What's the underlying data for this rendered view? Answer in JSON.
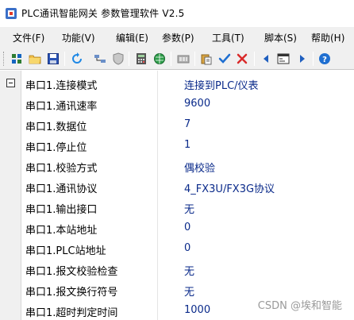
{
  "window": {
    "title": "PLC通讯智能网关 参数管理软件 V2.5"
  },
  "menu": [
    {
      "label": "文件(F)"
    },
    {
      "label": "功能(V)"
    },
    {
      "label": "编辑(E)"
    },
    {
      "label": "参数(P)"
    },
    {
      "label": "工具(T)"
    },
    {
      "label": "脚本(S)"
    },
    {
      "label": "帮助(H)"
    }
  ],
  "toolbar": {
    "icons": [
      "grid-tool-icon",
      "open-folder-icon",
      "save-icon",
      "refresh-icon",
      "network-icon",
      "shield-icon",
      "calculator-icon",
      "world-icon",
      "device-icon",
      "paste-icon",
      "check-icon",
      "delete-icon",
      "prev-icon",
      "terminal-icon",
      "next-icon",
      "help-icon"
    ]
  },
  "properties": [
    {
      "label": "串口1.连接模式",
      "value": "连接到PLC/仪表"
    },
    {
      "label": "串口1.通讯速率",
      "value": "9600"
    },
    {
      "label": "串口1.数据位",
      "value": "7"
    },
    {
      "label": "串口1.停止位",
      "value": "1"
    },
    {
      "label": "串口1.校验方式",
      "value": "偶校验"
    },
    {
      "label": "串口1.通讯协议",
      "value": "4_FX3U/FX3G协议"
    },
    {
      "label": "串口1.输出接口",
      "value": "无"
    },
    {
      "label": "串口1.本站地址",
      "value": "0"
    },
    {
      "label": "串口1.PLC站地址",
      "value": "0"
    },
    {
      "label": "串口1.报文校验检查",
      "value": "无"
    },
    {
      "label": "串口1.报文换行符号",
      "value": "无"
    },
    {
      "label": "串口1.超时判定时间",
      "value": "1000"
    }
  ],
  "watermark": "CSDN @埃和智能",
  "colors": {
    "value_text": "#0a2a8a",
    "menu_bg": "#f0f0f0"
  }
}
